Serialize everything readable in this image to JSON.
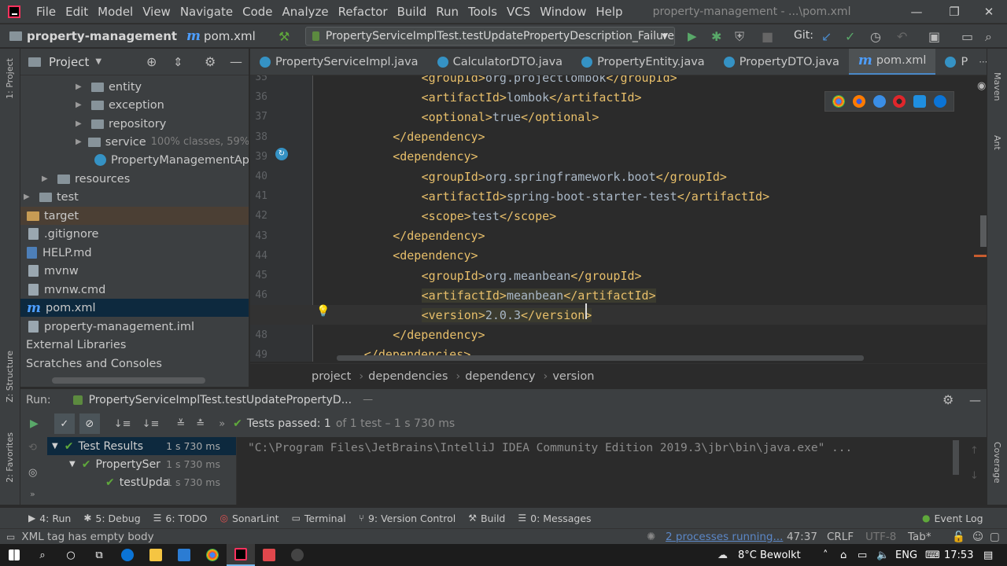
{
  "menubar": {
    "items": [
      "File",
      "Edit",
      "Model",
      "View",
      "Navigate",
      "Code",
      "Analyze",
      "Refactor",
      "Build",
      "Run",
      "Tools",
      "VCS",
      "Window",
      "Help"
    ],
    "window_title": "property-management - ...\\pom.xml"
  },
  "navbar": {
    "project": "property-management",
    "file": "pom.xml",
    "run_config": "PropertyServiceImplTest.testUpdatePropertyDescription_Failure",
    "git_label": "Git:"
  },
  "left_stripe": {
    "project_label": "1: Project",
    "structure_label": "Z: Structure",
    "favorites_label": "2: Favorites"
  },
  "right_stripe": {
    "maven_label": "Maven",
    "ant_label": "Ant",
    "coverage_label": "Coverage"
  },
  "project_panel": {
    "title": "Project",
    "items": [
      {
        "label": "entity",
        "extra": ""
      },
      {
        "label": "exception",
        "extra": ""
      },
      {
        "label": "repository",
        "extra": ""
      },
      {
        "label": "service",
        "extra": "100% classes, 59%"
      },
      {
        "label": "PropertyManagementAppli",
        "extra": ""
      },
      {
        "label": "resources",
        "extra": ""
      },
      {
        "label": "test",
        "extra": ""
      },
      {
        "label": "target",
        "extra": ""
      },
      {
        "label": ".gitignore",
        "extra": ""
      },
      {
        "label": "HELP.md",
        "extra": ""
      },
      {
        "label": "mvnw",
        "extra": ""
      },
      {
        "label": "mvnw.cmd",
        "extra": ""
      },
      {
        "label": "pom.xml",
        "extra": ""
      },
      {
        "label": "property-management.iml",
        "extra": ""
      },
      {
        "label": "External Libraries",
        "extra": ""
      },
      {
        "label": "Scratches and Consoles",
        "extra": ""
      }
    ]
  },
  "tabs": [
    {
      "label": "PropertyServiceImpl.java"
    },
    {
      "label": "CalculatorDTO.java"
    },
    {
      "label": "PropertyEntity.java"
    },
    {
      "label": "PropertyDTO.java"
    },
    {
      "label": "pom.xml"
    },
    {
      "label": "P"
    }
  ],
  "editor": {
    "lines": [
      {
        "n": "35",
        "tag1": "<groupId>",
        "text": "org.projectlombok",
        "tag2": "</groupId>"
      },
      {
        "n": "36",
        "tag1": "<artifactId>",
        "text": "lombok",
        "tag2": "</artifactId>"
      },
      {
        "n": "37",
        "tag1": "<optional>",
        "text": "true",
        "tag2": "</optional>"
      },
      {
        "n": "38",
        "tag1": "</dependency>",
        "text": "",
        "tag2": ""
      },
      {
        "n": "39",
        "tag1": "<dependency>",
        "text": "",
        "tag2": ""
      },
      {
        "n": "40",
        "tag1": "<groupId>",
        "text": "org.springframework.boot",
        "tag2": "</groupId>"
      },
      {
        "n": "41",
        "tag1": "<artifactId>",
        "text": "spring-boot-starter-test",
        "tag2": "</artifactId>"
      },
      {
        "n": "42",
        "tag1": "<scope>",
        "text": "test",
        "tag2": "</scope>"
      },
      {
        "n": "43",
        "tag1": "</dependency>",
        "text": "",
        "tag2": ""
      },
      {
        "n": "44",
        "tag1": "<dependency>",
        "text": "",
        "tag2": ""
      },
      {
        "n": "45",
        "tag1": "<groupId>",
        "text": "org.meanbean",
        "tag2": "</groupId>"
      },
      {
        "n": "46",
        "tag1": "<artifactId>",
        "text": "meanbean",
        "tag2": "</artifactId>"
      },
      {
        "n": "47",
        "tag1": "<version>",
        "text": "2.0.3",
        "tag2": "</version>"
      },
      {
        "n": "48",
        "tag1": "</dependency>",
        "text": "",
        "tag2": ""
      },
      {
        "n": "49",
        "tag1": "</dependencies>",
        "text": "",
        "tag2": ""
      }
    ]
  },
  "breadcrumbs": [
    "project",
    "dependencies",
    "dependency",
    "version"
  ],
  "run": {
    "label": "Run:",
    "config": "PropertyServiceImplTest.testUpdatePropertyD...",
    "tests_passed": "Tests passed: 1",
    "tests_detail": "of 1 test – 1 s 730 ms",
    "console_text": "\"C:\\Program Files\\JetBrains\\IntelliJ IDEA Community Edition 2019.3\\jbr\\bin\\java.exe\" ...",
    "results": [
      {
        "label": "Test Results",
        "time": "1 s 730 ms"
      },
      {
        "label": "PropertySer",
        "time": "1 s 730 ms"
      },
      {
        "label": "testUpda",
        "time": "1 s 730 ms"
      }
    ]
  },
  "tool_buttons": {
    "run": "4: Run",
    "debug": "5: Debug",
    "todo": "6: TODO",
    "sonarlint": "SonarLint",
    "terminal": "Terminal",
    "vcs": "9: Version Control",
    "build": "Build",
    "messages": "0: Messages",
    "event_log": "Event Log"
  },
  "status": {
    "message": "XML tag has empty body",
    "processes": "2 processes running...",
    "position": "47:37",
    "line_sep": "CRLF",
    "encoding": "UTF-8",
    "indent": "Tab*"
  },
  "taskbar": {
    "weather": "8°C  Bewolkt",
    "lang": "ENG",
    "time": "17:53"
  },
  "colors": {
    "accent": "#4a88c7",
    "pass": "#5fa83b",
    "tag": "#e8bf6a",
    "text": "#a9b7c6"
  }
}
